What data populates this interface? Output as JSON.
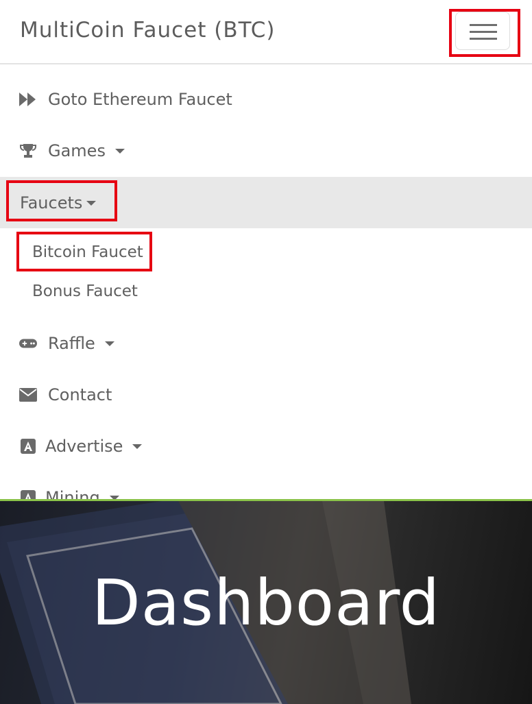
{
  "navbar": {
    "brand": "MultiCoin Faucet (BTC)"
  },
  "menu": {
    "items": [
      {
        "label": "Goto Ethereum Faucet",
        "icon": "fast-forward-icon",
        "dropdown": false
      },
      {
        "label": "Games",
        "icon": "trophy-icon",
        "dropdown": true
      },
      {
        "label": "Faucets",
        "icon": "",
        "dropdown": true,
        "active": true
      },
      {
        "label": "Raffle",
        "icon": "gamepad-icon",
        "dropdown": true
      },
      {
        "label": "Contact",
        "icon": "envelope-icon",
        "dropdown": false
      },
      {
        "label": "Advertise",
        "icon": "a-square-icon",
        "dropdown": true
      },
      {
        "label": "Mining",
        "icon": "a-square-icon",
        "dropdown": true
      }
    ],
    "faucets_submenu": [
      "Bitcoin Faucet",
      "Bonus Faucet"
    ]
  },
  "hero": {
    "title": "Dashboard"
  },
  "colors": {
    "highlight_box": "#e60012",
    "active_row_bg": "#e8e8e8",
    "hero_accent": "#8bc34a"
  }
}
